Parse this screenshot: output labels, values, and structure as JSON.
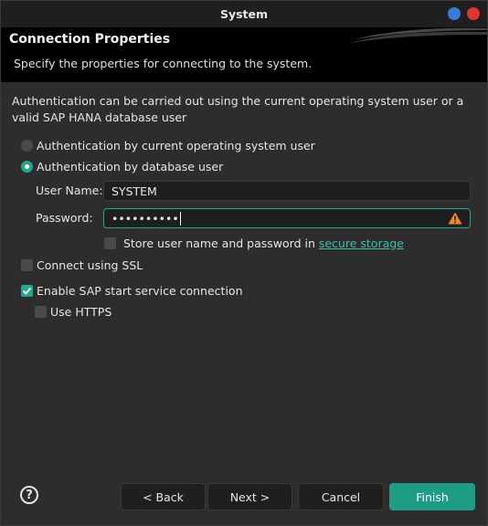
{
  "window": {
    "title": "System"
  },
  "banner": {
    "title": "Connection Properties",
    "subtitle": "Specify the properties for connecting to the system."
  },
  "description": "Authentication can be carried out using the current operating system user or a valid SAP HANA database user",
  "auth": {
    "os_user_label": "Authentication by current operating system user",
    "os_user_selected": false,
    "db_user_label": "Authentication by database user",
    "db_user_selected": true
  },
  "fields": {
    "username_label": "User Name:",
    "username_value": "SYSTEM",
    "password_label": "Password:",
    "password_value": "••••••••••",
    "password_warning_icon": "warning-triangle-icon"
  },
  "store": {
    "label_prefix": "Store user name and password in ",
    "link_text": "secure storage",
    "checked": false
  },
  "ssl": {
    "label": "Connect using SSL",
    "checked": false
  },
  "sap_start": {
    "label": "Enable SAP start service connection",
    "checked": true
  },
  "https": {
    "label": "Use HTTPS",
    "checked": false
  },
  "buttons": {
    "help": "?",
    "back": "< Back",
    "next": "Next >",
    "cancel": "Cancel",
    "finish": "Finish"
  },
  "colors": {
    "accent": "#26a68d",
    "window_min": "#3a7bd5",
    "window_close": "#e0342f",
    "warning": "#f08a24"
  }
}
